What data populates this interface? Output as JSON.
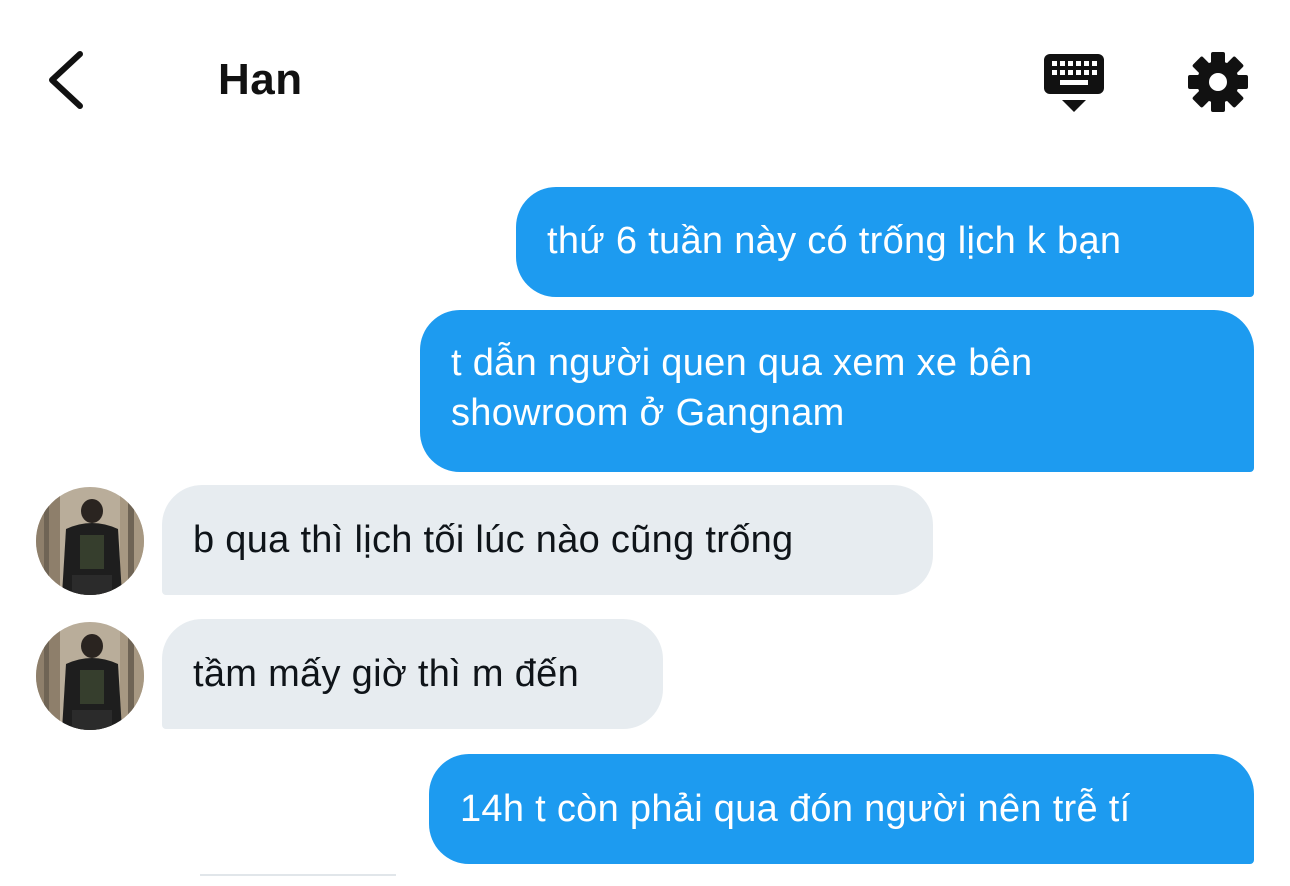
{
  "header": {
    "title": "Han",
    "back_icon": "chevron-left-icon",
    "keyboard_icon": "keyboard-icon",
    "settings_icon": "gear-icon"
  },
  "messages": [
    {
      "direction": "outgoing",
      "text": "thứ 6 tuần này có trống lịch k bạn"
    },
    {
      "direction": "outgoing",
      "lines": [
        "t dẫn người quen qua xem xe bên",
        "showroom ở Gangnam"
      ]
    },
    {
      "direction": "incoming",
      "text": "b qua thì lịch tối lúc nào cũng trống"
    },
    {
      "direction": "incoming",
      "text": "tầm mấy giờ thì m đến"
    },
    {
      "direction": "outgoing",
      "text": "14h t còn phải qua đón người nên trễ tí"
    }
  ],
  "colors": {
    "outgoing_bubble": "#1d9bf0",
    "incoming_bubble": "#e7ecf0",
    "outgoing_text": "#ffffff",
    "incoming_text": "#0f1419"
  }
}
